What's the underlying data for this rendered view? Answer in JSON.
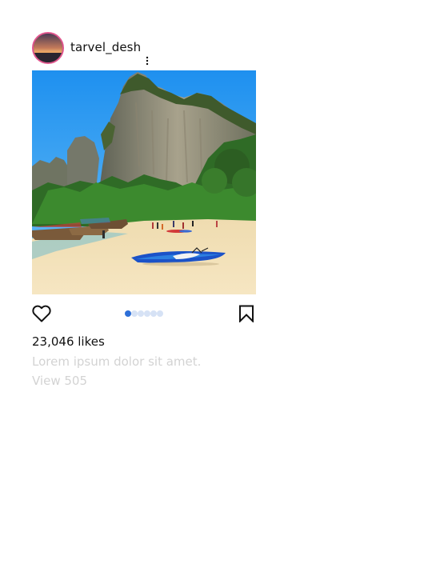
{
  "post": {
    "username": "tarvel_desh",
    "likes": "23,046 likes",
    "caption": "Lorem ipsum dolor sit amet.",
    "view_comments": "View 505",
    "carousel": {
      "total": 6,
      "active_index": 0
    }
  },
  "icons": {
    "more": "more-vertical-icon",
    "like": "heart-icon",
    "save": "bookmark-icon"
  },
  "colors": {
    "avatar_ring": "#e0578e",
    "dot_active": "#2d6fd8",
    "dot_inactive": "#d6e2f5",
    "muted_text": "#d3d3d3"
  }
}
